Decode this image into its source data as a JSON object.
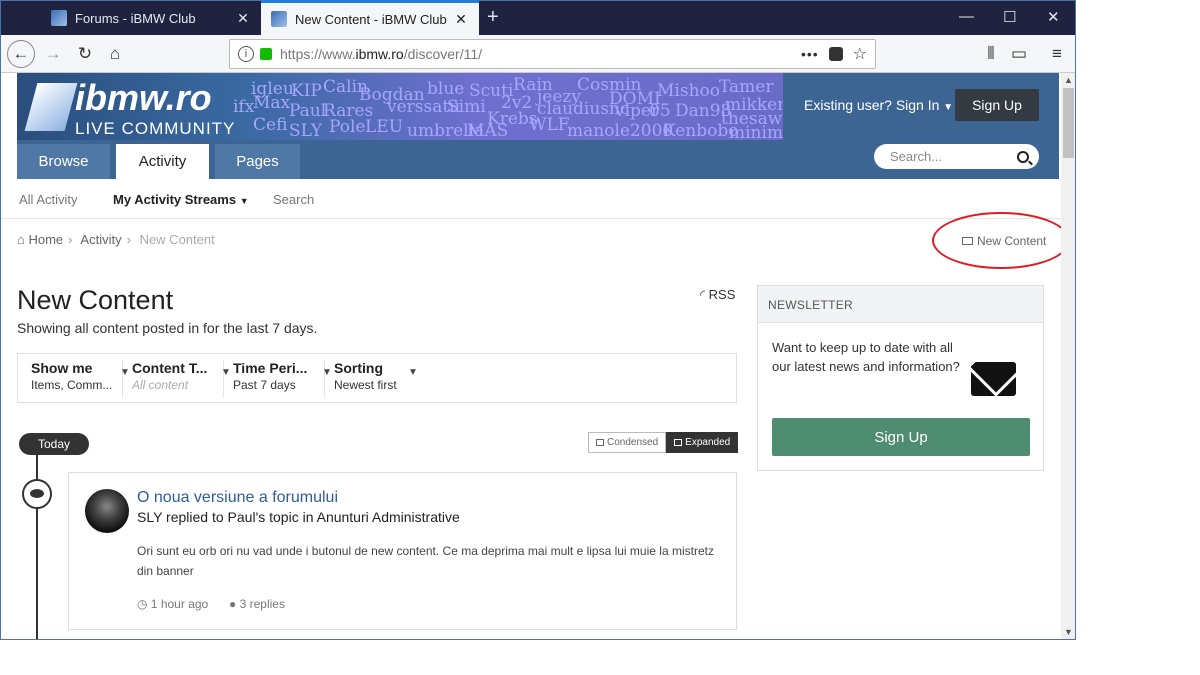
{
  "browser": {
    "tabs": [
      {
        "label": "Forums - iBMW Club",
        "active": false
      },
      {
        "label": "New Content - iBMW Club",
        "active": true
      }
    ],
    "url": "https://www.ibmw.ro/discover/11/",
    "url_prefix": "https://www.",
    "url_domain": "ibmw.ro",
    "url_path": "/discover/11/"
  },
  "site": {
    "logo_text": "ibmw.ro",
    "logo_sub": "LIVE COMMUNITY",
    "banner_names": [
      "igleu",
      "KIP",
      "Calin",
      "Bogdan",
      "blue",
      "Scuti",
      "Rain",
      "Cosmin",
      "Mishoo",
      "Tamer",
      "ifx",
      "Max",
      "Paul",
      "Rares",
      "verssatu",
      "Simi",
      "2v2",
      "jeezy",
      "claudiusnc",
      "DOMI",
      "viper",
      "05",
      "Dan98",
      "mikken",
      "Cefi",
      "SLY",
      "Pole",
      "LEU",
      "umbrella",
      "MAS",
      "Krebs",
      "WLF",
      "manole2000",
      "Kenbobo",
      "thesaw",
      "minima"
    ],
    "signin_label": "Existing user? Sign In",
    "signup_label": "Sign Up",
    "main_tabs": [
      "Browse",
      "Activity",
      "Pages"
    ],
    "search_placeholder": "Search..."
  },
  "subnav": {
    "all_activity": "All Activity",
    "my_streams": "My Activity Streams",
    "search": "Search"
  },
  "breadcrumb": {
    "home": "Home",
    "activity": "Activity",
    "current": "New Content",
    "new_content_link": "New Content"
  },
  "main": {
    "title": "New Content",
    "subtitle": "Showing all content posted in for the last 7 days.",
    "rss": "RSS",
    "filters": [
      {
        "title": "Show me",
        "value": "Items, Comm..."
      },
      {
        "title": "Content T...",
        "value": "All content"
      },
      {
        "title": "Time Peri...",
        "value": "Past 7 days"
      },
      {
        "title": "Sorting",
        "value": "Newest first"
      }
    ]
  },
  "newsletter": {
    "header": "NEWSLETTER",
    "body": "Want to keep up to date with all our latest news and information?",
    "signup": "Sign Up"
  },
  "timeline": {
    "today": "Today",
    "view_condensed": "Condensed",
    "view_expanded": "Expanded",
    "entries": [
      {
        "title": "O noua versiune a forumului",
        "meta": "SLY replied to Paul's topic in Anunturi Administrative",
        "body": "Ori sunt eu orb ori nu vad unde i butonul de new content. Ce ma deprima mai mult e lipsa lui muie la mistretz din banner",
        "time": "1 hour ago",
        "replies": "3 replies"
      }
    ]
  }
}
